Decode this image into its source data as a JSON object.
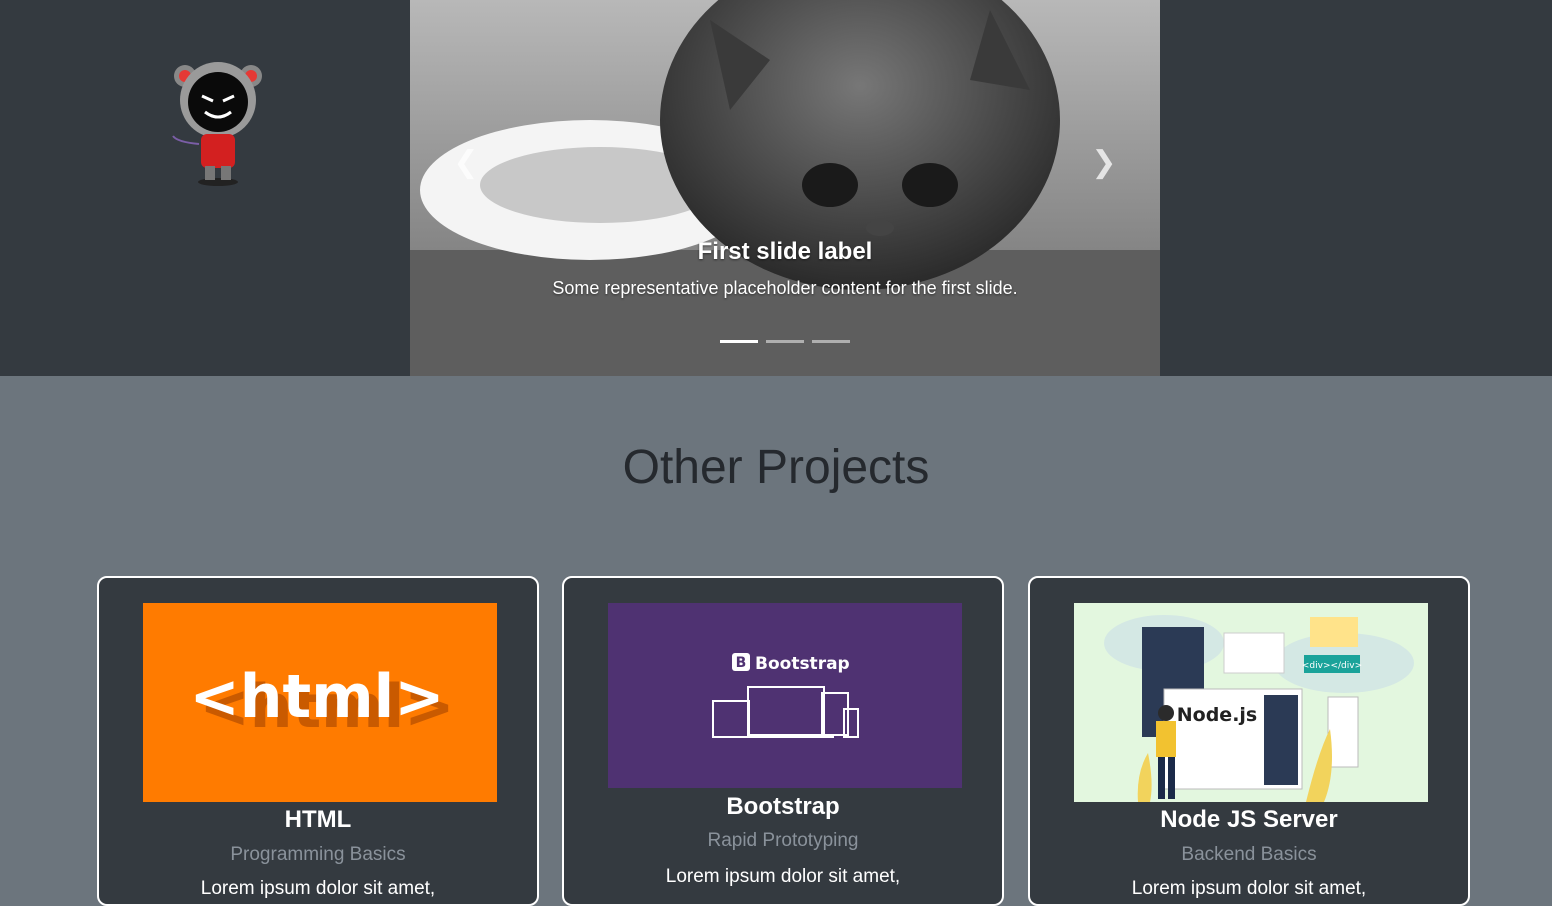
{
  "carousel": {
    "slide_label": "First slide label",
    "slide_text": "Some representative placeholder content for the first slide.",
    "prev_icon": "chevron-left-icon",
    "next_icon": "chevron-right-icon",
    "indicator_count": 3,
    "active_index": 0
  },
  "section": {
    "title": "Other Projects"
  },
  "cards": [
    {
      "title": "HTML",
      "subtitle": "Programming Basics",
      "text": "Lorem ipsum dolor sit amet,",
      "image_text": "<html>",
      "image_bg": "#ff7b00"
    },
    {
      "title": "Bootstrap",
      "subtitle": "Rapid Prototyping",
      "text": "Lorem ipsum dolor sit amet,",
      "image_text": "Bootstrap",
      "image_bg": "#4f3272"
    },
    {
      "title": "Node JS Server",
      "subtitle": "Backend Basics",
      "text": "Lorem ipsum dolor sit amet,",
      "image_text": "Node.js",
      "image_tag": "<div></div>",
      "image_bg": "#e3f7df"
    }
  ],
  "colors": {
    "page_bg": "#6c757d",
    "dark_bg": "#343a40",
    "title_color": "#25292e",
    "muted_text": "#8a929b"
  }
}
